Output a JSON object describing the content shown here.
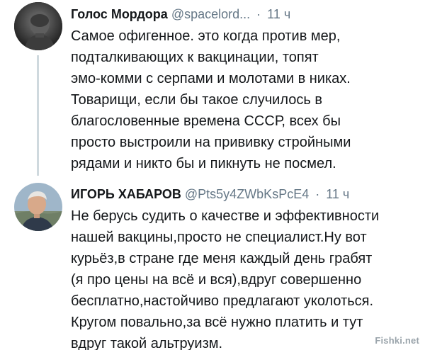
{
  "tweets": [
    {
      "author_name": "Голос Мордора",
      "handle": "@spacelord...",
      "separator": "·",
      "time": "11 ч",
      "paragraphs": [
        "Самое офигенное. это когда против мер,\nподталкивающих к вакцинации, топят\nэмо-комми с серпами и молотами в никах.",
        "Товарищи, если бы такое случилось в\nблагословенные времена СССР, всех бы\nпросто выстроили на прививку стройными\nрядами и никто бы и пикнуть не посмел."
      ]
    },
    {
      "author_name": "ИГОРЬ ХАБАРОВ",
      "handle": "@Pts5y4ZWbKsPcE4",
      "separator": "·",
      "time": "11 ч",
      "paragraphs": [
        "Не берусь судить о качестве и эффективности\nнашей вакцины,просто не специалист.Ну вот\nкурьёз,в стране где меня каждый  день грабят\n(я про цены на всё и вся),вдруг совершенно\nбесплатно,настойчиво предлагают уколоться.\nКругом повально,за всё нужно платить и тут\nвдруг такой альтруизм."
      ]
    }
  ],
  "icons": {
    "avatar_1": "avatar-dark-portrait",
    "avatar_2": "avatar-man-photo",
    "menu": "chevron-down-icon"
  },
  "watermark": "Fishki.net",
  "colors": {
    "text": "#14171a",
    "secondary": "#657786",
    "thread_line": "#cfd9de"
  }
}
